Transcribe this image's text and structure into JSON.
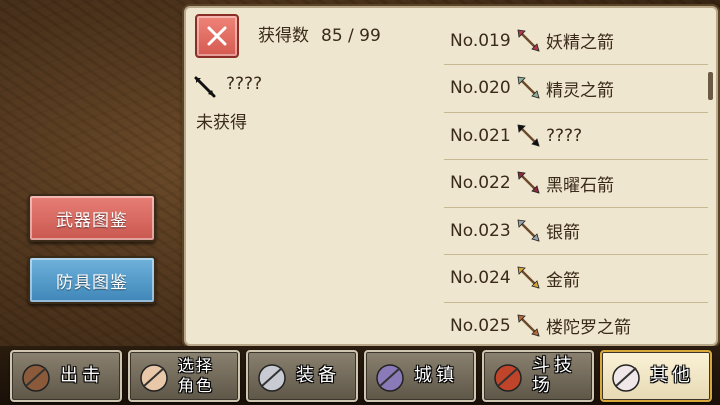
{
  "sidebar": {
    "weapon_codex": "武器图鉴",
    "armor_codex": "防具图鉴"
  },
  "panel": {
    "count_label": "获得数",
    "count_value": "85 / 99",
    "selected": {
      "name": "????",
      "status": "未获得",
      "icon": "black-arrow-icon"
    }
  },
  "list": [
    {
      "num": "No.019",
      "name": "妖精之箭",
      "icon": "fairy-arrow-icon",
      "color": "#b03a4a"
    },
    {
      "num": "No.020",
      "name": "精灵之箭",
      "icon": "elf-arrow-icon",
      "color": "#8fae9a"
    },
    {
      "num": "No.021",
      "name": "????",
      "icon": "unknown-arrow-icon",
      "color": "#111111"
    },
    {
      "num": "No.022",
      "name": "黑曜石箭",
      "icon": "obsidian-arrow-icon",
      "color": "#8a2a3a"
    },
    {
      "num": "No.023",
      "name": "银箭",
      "icon": "silver-arrow-icon",
      "color": "#9aa4ad"
    },
    {
      "num": "No.024",
      "name": "金箭",
      "icon": "gold-arrow-icon",
      "color": "#d4a436"
    },
    {
      "num": "No.025",
      "name": "楼陀罗之箭",
      "icon": "rudra-arrow-icon",
      "color": "#b36a3a"
    }
  ],
  "nav": [
    {
      "label": "出击",
      "icon": "sortie-icon"
    },
    {
      "label": "选择\n角色",
      "icon": "character-select-icon"
    },
    {
      "label": "装备",
      "icon": "equipment-icon"
    },
    {
      "label": "城镇",
      "icon": "town-icon"
    },
    {
      "label": "斗技场",
      "icon": "arena-icon"
    },
    {
      "label": "其他",
      "icon": "other-icon"
    }
  ],
  "colors": {
    "weapon_btn": "#d9665e",
    "armor_btn": "#4f95c4",
    "parchment": "#efe6cf",
    "active_nav_border": "#d8a83a"
  }
}
